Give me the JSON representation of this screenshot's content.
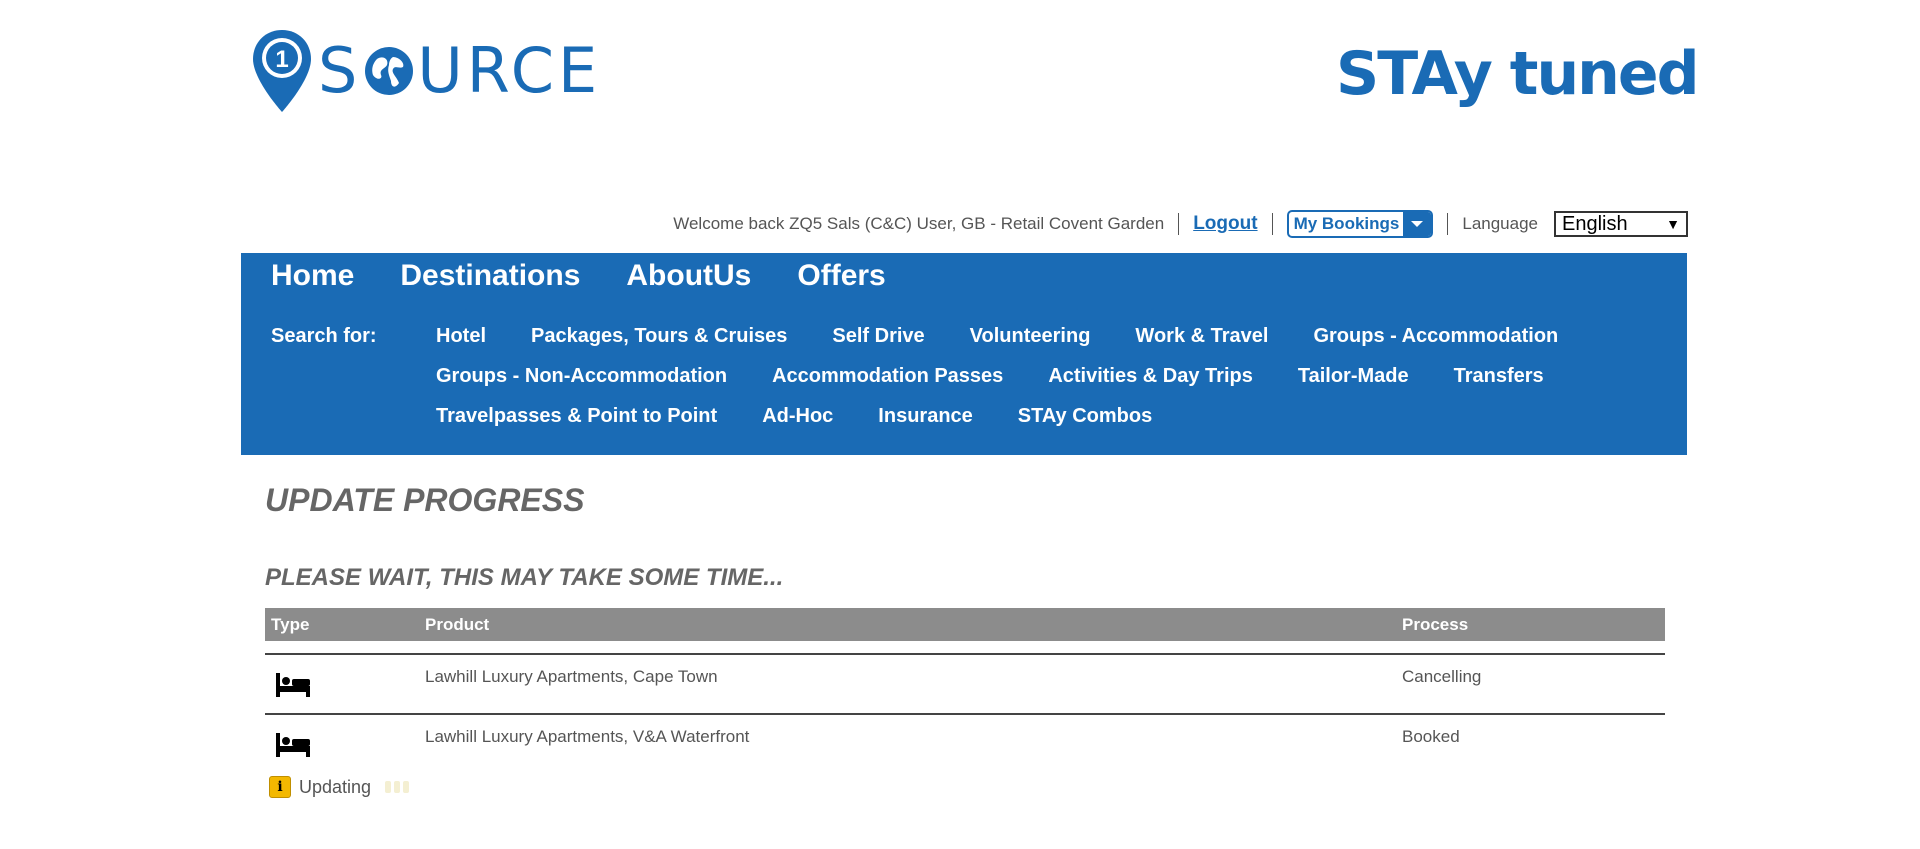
{
  "logos": {
    "left_text": "SOURCE",
    "left_pin_text": "1",
    "right_text": "STAy tuned"
  },
  "topbar": {
    "welcome": "Welcome back ZQ5 Sals (C&C) User, GB - Retail Covent Garden",
    "logout": "Logout",
    "my_bookings": "My Bookings",
    "language_label": "Language",
    "language_value": "English"
  },
  "nav": {
    "main": [
      "Home",
      "Destinations",
      "AboutUs",
      "Offers"
    ],
    "search_for": "Search for:",
    "links": [
      "Hotel",
      "Packages, Tours & Cruises",
      "Self Drive",
      "Volunteering",
      "Work & Travel",
      "Groups - Accommodation",
      "Groups - Non-Accommodation",
      "Accommodation Passes",
      "Activities & Day Trips",
      "Tailor-Made",
      "Transfers",
      "Travelpasses & Point to Point",
      "Ad-Hoc",
      "Insurance",
      "STAy Combos"
    ]
  },
  "content": {
    "title": "UPDATE PROGRESS",
    "subtitle": "PLEASE WAIT, THIS MAY TAKE SOME TIME...",
    "table": {
      "headers": {
        "type": "Type",
        "product": "Product",
        "process": "Process"
      },
      "rows": [
        {
          "type_icon": "bed-icon",
          "product": "Lawhill Luxury Apartments, Cape Town",
          "process": "Cancelling"
        },
        {
          "type_icon": "bed-icon",
          "product": "Lawhill Luxury Apartments, V&A Waterfront",
          "process": "Booked"
        }
      ]
    },
    "status": {
      "icon": "info-icon",
      "text": "Updating"
    }
  },
  "colors": {
    "brand_blue": "#1a6bb5",
    "header_gray": "#8c8c8c",
    "info_yellow": "#f3b800"
  }
}
